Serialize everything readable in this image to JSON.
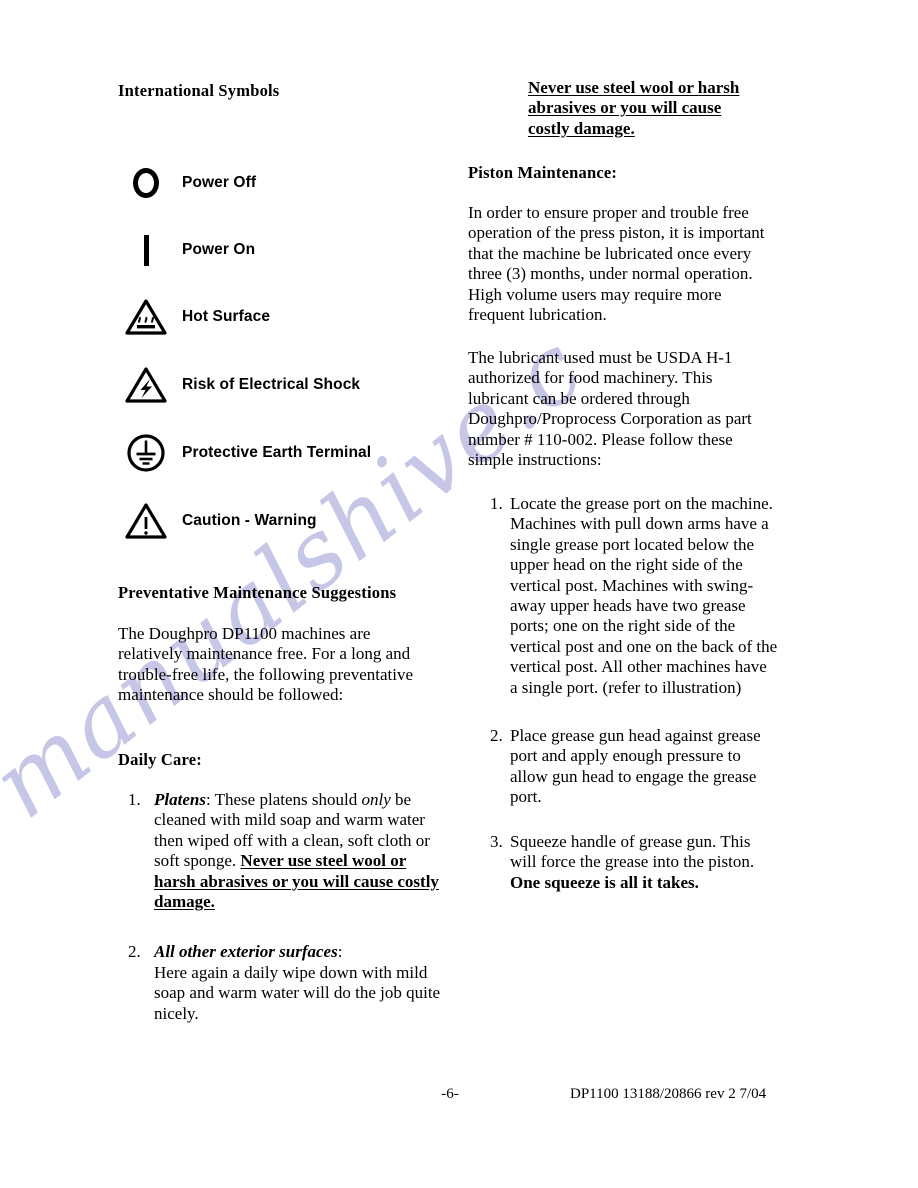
{
  "document": {
    "background_color": "#ffffff",
    "text_color": "#000000",
    "watermark": {
      "text": "manualshive.c",
      "color": "#c3c3e6"
    }
  },
  "left_column": {
    "symbols_heading": "International Symbols",
    "symbols": [
      {
        "icon": "power-off-icon",
        "label": "Power Off"
      },
      {
        "icon": "power-on-icon",
        "label": "Power On"
      },
      {
        "icon": "hot-surface-icon",
        "label": "Hot Surface"
      },
      {
        "icon": "electrical-shock-icon",
        "label": "Risk of Electrical Shock"
      },
      {
        "icon": "protective-earth-terminal-icon",
        "label": "Protective Earth Terminal"
      },
      {
        "icon": "caution-warning-icon",
        "label": "Caution - Warning"
      }
    ],
    "maintenance_heading": "Preventative Maintenance Suggestions",
    "maintenance_paragraph": "The Doughpro DP1100 machines are relatively maintenance free.  For a long and trouble-free life, the following preventative maintenance should be followed:",
    "daily_care_heading": "Daily Care:",
    "daily_care_items": [
      {
        "number": "1.",
        "term": "Platens",
        "colon": ":",
        "text_before_emphasis": "  These platens should ",
        "emphasis": "only",
        "text_after_emphasis": " be cleaned with mild soap and warm water then wiped off with a clean, soft cloth or soft sponge.  ",
        "warning": "Never use steel wool or harsh abrasives or you will cause costly damage."
      },
      {
        "number": "2.",
        "term": "All other exterior surfaces",
        "colon": ":",
        "text": "Here again a daily wipe down with mild soap and warm water will do the job quite nicely."
      }
    ]
  },
  "right_column": {
    "warning_banner": "Never use steel wool or harsh abrasives or you will cause costly damage.",
    "piston_heading": "Piston Maintenance:",
    "piston_paragraph_1": "In order to ensure proper and trouble free operation of the press piston, it is important that the machine be lubricated once every three (3) months, under normal operation.  High volume users may require more frequent lubrication.",
    "piston_paragraph_2": "The lubricant used must be USDA H-1 authorized for food machinery.  This lubricant can be ordered through Doughpro/Proprocess Corporation as part number # 110-002.  Please follow these simple instructions:",
    "steps": [
      {
        "number": "1.",
        "text": "Locate the grease port on the machine.  Machines with pull down arms have a single grease port located below the upper head on the right side of the vertical post.  Machines with swing-away upper heads have two grease ports; one on the right side of the vertical post and one on the back of the vertical post.  All other machines have a single port. (refer to illustration)"
      },
      {
        "number": "2.",
        "text": "Place grease gun head against grease port and apply enough pressure to allow gun head to engage the grease port."
      },
      {
        "number": "3.",
        "text_plain": "Squeeze handle of grease gun.  This will force the grease into the piston.  ",
        "text_bold": "One squeeze is all it takes."
      }
    ]
  },
  "footer": {
    "page_number": "-6-",
    "reference": "DP1100 13188/20866 rev 2 7/04"
  }
}
